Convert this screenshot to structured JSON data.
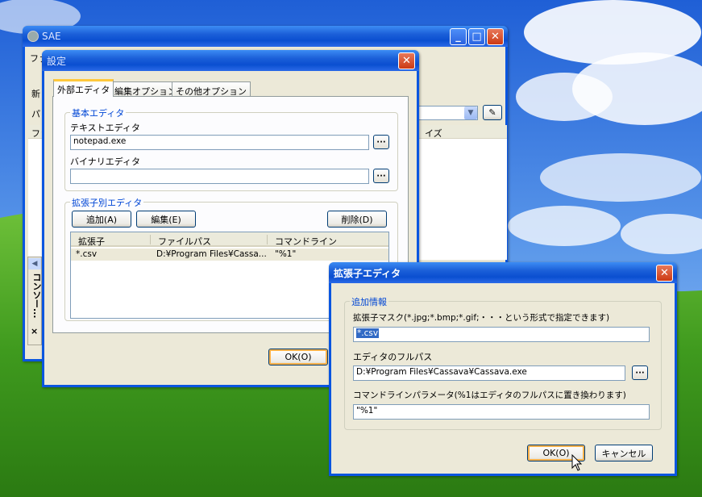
{
  "sae_window": {
    "title": "SAE",
    "menu_fragment": "ファ",
    "toolbar_fragment": "新",
    "path_fragment": "パ",
    "list_header_left": "ファ",
    "list_header_right": "イズ",
    "side_panel_label": "コンソー...",
    "side_close": "×"
  },
  "settings_dialog": {
    "title": "設定",
    "tabs": [
      "外部エディタ",
      "編集オプション",
      "その他オプション"
    ],
    "basic_group": {
      "title": "基本エディタ",
      "text_editor_label": "テキストエディタ",
      "text_editor_value": "notepad.exe",
      "binary_editor_label": "バイナリエディタ",
      "binary_editor_value": ""
    },
    "ext_group": {
      "title": "拡張子別エディタ",
      "add_button": "追加(A)",
      "edit_button": "編集(E)",
      "delete_button": "削除(D)",
      "columns": [
        "拡張子",
        "ファイルパス",
        "コマンドライン"
      ],
      "rows": [
        {
          "ext": "*.csv",
          "path": "D:¥Program Files¥Cassa...",
          "cmd": "\"%1\""
        }
      ]
    },
    "ok_button": "OK(O)"
  },
  "ext_editor_dialog": {
    "title": "拡張子エディタ",
    "group_title": "追加情報",
    "mask_label": "拡張子マスク(*.jpg;*.bmp;*.gif;・・・という形式で指定できます)",
    "mask_value": "*.csv",
    "path_label": "エディタのフルパス",
    "path_value": "D:¥Program Files¥Cassava¥Cassava.exe",
    "param_label": "コマンドラインパラメータ(%1はエディタのフルパスに置き換わります)",
    "param_value": "\"%1\"",
    "ok_button": "OK(O)",
    "cancel_button": "キャンセル"
  },
  "colors": {
    "titlebar": "#0a4fd0",
    "dialog_bg": "#ece9d8",
    "group_title": "#0046d5",
    "selection": "#316ac5"
  }
}
